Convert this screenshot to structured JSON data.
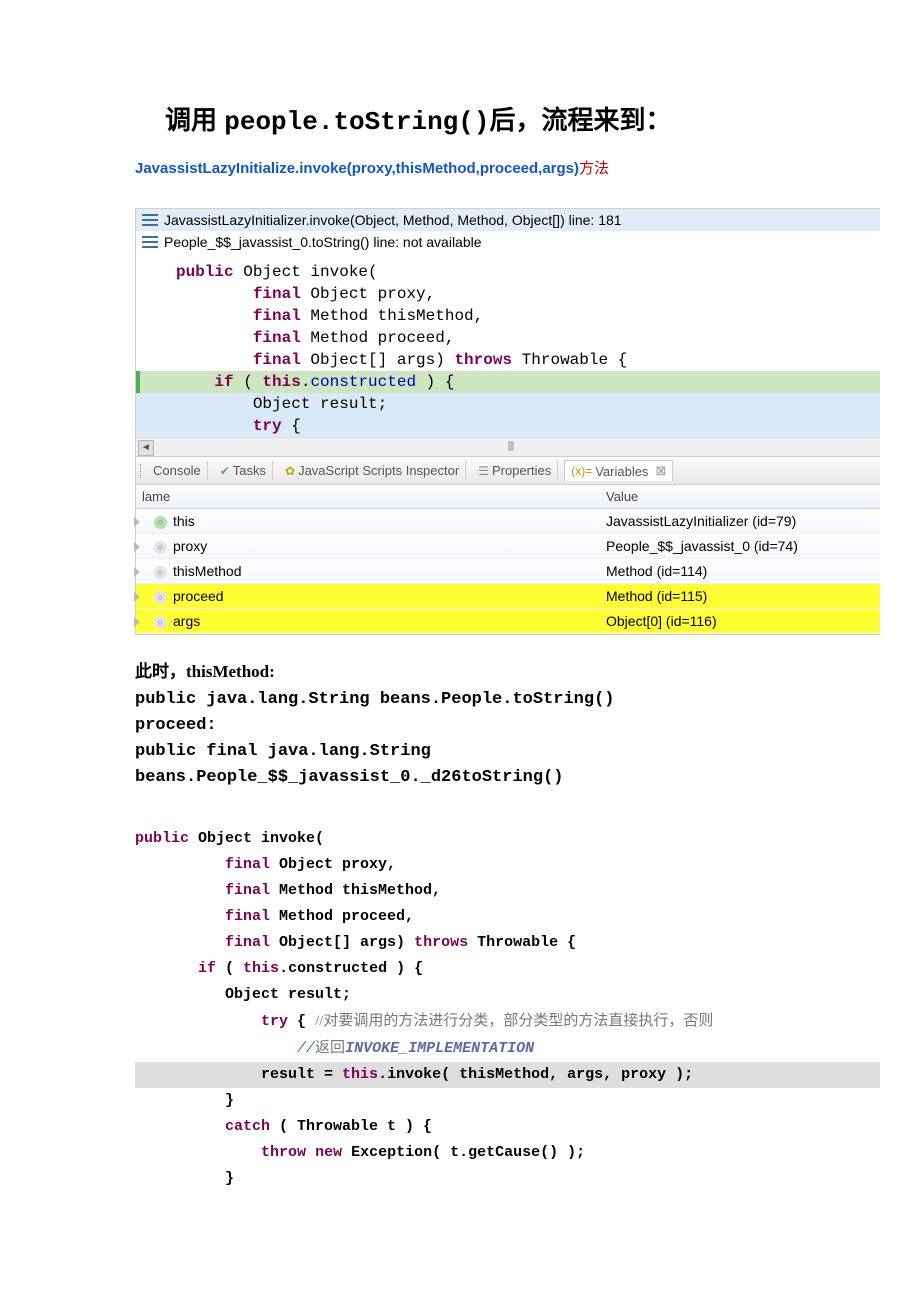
{
  "title": {
    "pre": "调用 ",
    "code": "people.toString()",
    "post": "后，流程来到："
  },
  "subtitle": {
    "blue": "JavassistLazyInitialize.invoke(proxy,thisMethod,proceed,args)",
    "red": "方法"
  },
  "stack": [
    "JavassistLazyInitializer.invoke(Object, Method, Method, Object[]) line: 181",
    "People_$$_javassist_0.toString() line: not available"
  ],
  "code1": {
    "l1a": "public",
    "l1b": " Object invoke(",
    "l2a": "final",
    "l2b": " Object proxy,",
    "l3a": "final",
    "l3b": " Method thisMethod,",
    "l4a": "final",
    "l4b": " Method proceed,",
    "l5a": "final",
    "l5b": " Object[] args) ",
    "l5c": "throws",
    "l5d": " Throwable {",
    "l6a": "if",
    "l6b": " ( ",
    "l6c": "this",
    "l6d": ".",
    "l6e": "constructed",
    "l6f": " ) {",
    "l7": "Object result;",
    "l8a": "try",
    "l8b": " {"
  },
  "tabs": {
    "console": "Console",
    "tasks": "Tasks",
    "js": "JavaScript Scripts Inspector",
    "props": "Properties",
    "vars": "Variables"
  },
  "vars": {
    "h1": "lame",
    "h2": "Value",
    "rows": [
      {
        "name": "this",
        "value": "JavassistLazyInitializer  (id=79)",
        "type": "green",
        "tri": true
      },
      {
        "name": "proxy",
        "value": "People_$$_javassist_0  (id=74)",
        "type": "grey",
        "tri": true
      },
      {
        "name": "thisMethod",
        "value": "Method  (id=114)",
        "type": "grey",
        "tri": true
      },
      {
        "name": "proceed",
        "value": "Method  (id=115)",
        "type": "grey",
        "tri": true,
        "yellow": true
      },
      {
        "name": "args",
        "value": "Object[0]  (id=116)",
        "type": "grey",
        "tri": true,
        "yellow": true
      }
    ]
  },
  "body": {
    "l1": "此时，thisMethod:",
    "l2": "public java.lang.String beans.People.toString()",
    "l3": "proceed:",
    "l4": "public final java.lang.String",
    "l5": "beans.People_$$_javassist_0._d26toString()"
  },
  "code2": {
    "l1": {
      "a": "public",
      "b": " Object invoke("
    },
    "l2": {
      "a": "final",
      "b": " Object proxy,"
    },
    "l3": {
      "a": "final",
      "b": " Method thisMethod,"
    },
    "l4": {
      "a": "final",
      "b": " Method proceed,"
    },
    "l5": {
      "a": "final",
      "b": " Object[] args) ",
      "c": "throws",
      "d": " Throwable {"
    },
    "l6": {
      "a": "if",
      "b": " ( ",
      "c": "this",
      "d": ".constructed ) {"
    },
    "l7": "Object result;",
    "l8": {
      "a": "try",
      "b": " { ",
      "c": "//对要调用的方法进行分类，部分类型的方法直接执行，否则"
    },
    "l9": {
      "a": "//",
      "b": "返回",
      "c": "INVOKE_IMPLEMENTATION"
    },
    "l10": {
      "a": "result = ",
      "b": "this",
      "c": ".invoke( thisMethod, args, proxy );"
    },
    "l11": "}",
    "l12": {
      "a": "catch",
      "b": " ( Throwable t ) {"
    },
    "l13": {
      "a": "throw",
      "b": " ",
      "c": "new",
      "d": " Exception( t.getCause() );"
    },
    "l14": "}"
  }
}
